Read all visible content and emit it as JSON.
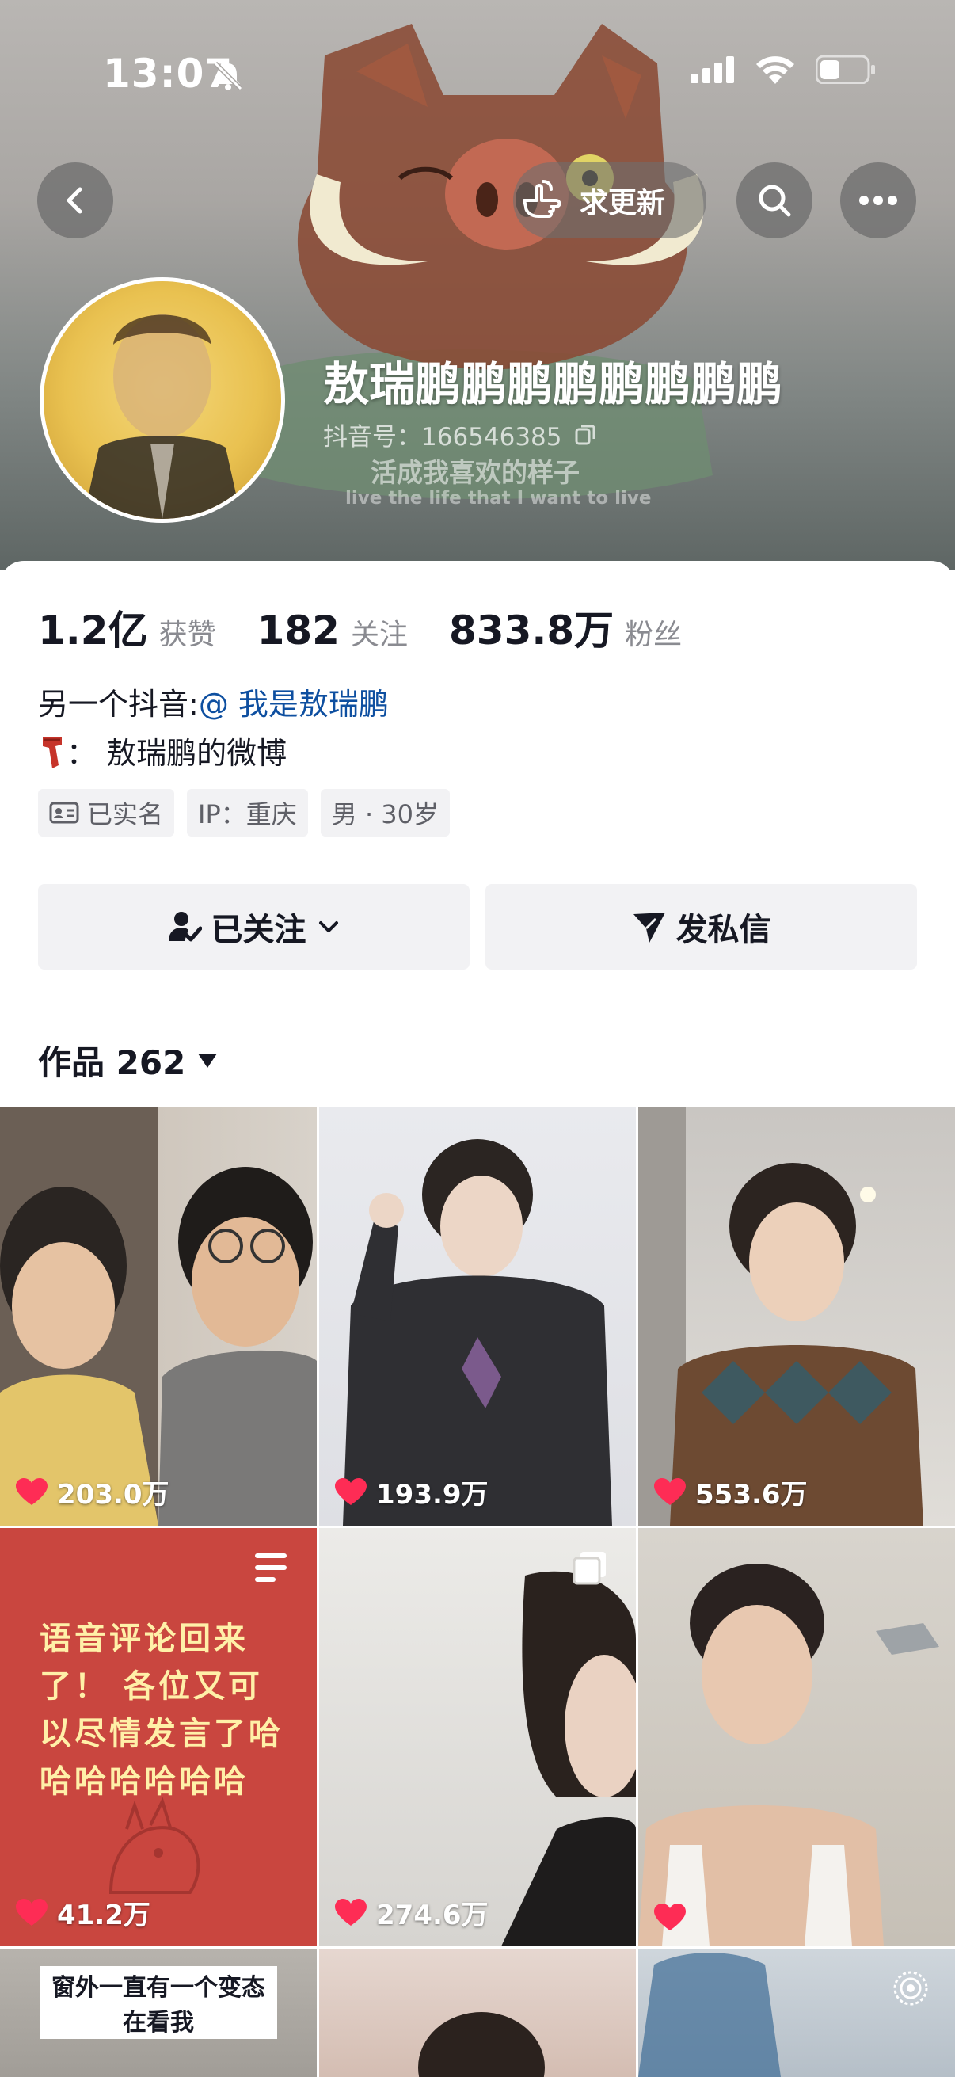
{
  "status_bar": {
    "time": "13:07"
  },
  "header": {
    "update_label": "求更新",
    "nickname": "敖瑞鹏鹏鹏鹏鹏鹏鹏鹏",
    "douyin_id": "抖音号：166546385",
    "banner_slogan_cn": "活成我喜欢的样子",
    "banner_slogan_en": "live the life that I want to live"
  },
  "stats": [
    {
      "num": "1.2亿",
      "unit": "获赞"
    },
    {
      "num": "182",
      "unit": "关注"
    },
    {
      "num": "833.8万",
      "unit": "粉丝"
    }
  ],
  "bio": {
    "line1_prefix": "另一个抖音:",
    "line1_mention": "@ 我是敖瑞鹏",
    "line2": "：  敖瑞鹏的微博"
  },
  "tags": [
    {
      "icon": "id-card-icon",
      "label": "已实名"
    },
    {
      "icon": "",
      "label": "IP：重庆"
    },
    {
      "icon": "",
      "label": "男 · 30岁"
    }
  ],
  "actions": {
    "follow_label": "已关注",
    "message_label": "发私信"
  },
  "works": {
    "label": "作品 262"
  },
  "videos": [
    {
      "likes": "203.0万"
    },
    {
      "likes": "193.9万"
    },
    {
      "likes": "553.6万"
    },
    {
      "likes": "41.2万",
      "overlay_text": "语音评论回来了！ 各位又可以尽情发言了哈哈哈哈哈哈哈"
    },
    {
      "likes": "274.6万"
    },
    {
      "likes": ""
    },
    {
      "caption": "窗外一直有一个变态在看我"
    },
    {},
    {}
  ],
  "colors": {
    "like_red": "#fe2c55",
    "mention_blue": "#0e4fa0",
    "tag_bg": "#f2f2f4"
  }
}
